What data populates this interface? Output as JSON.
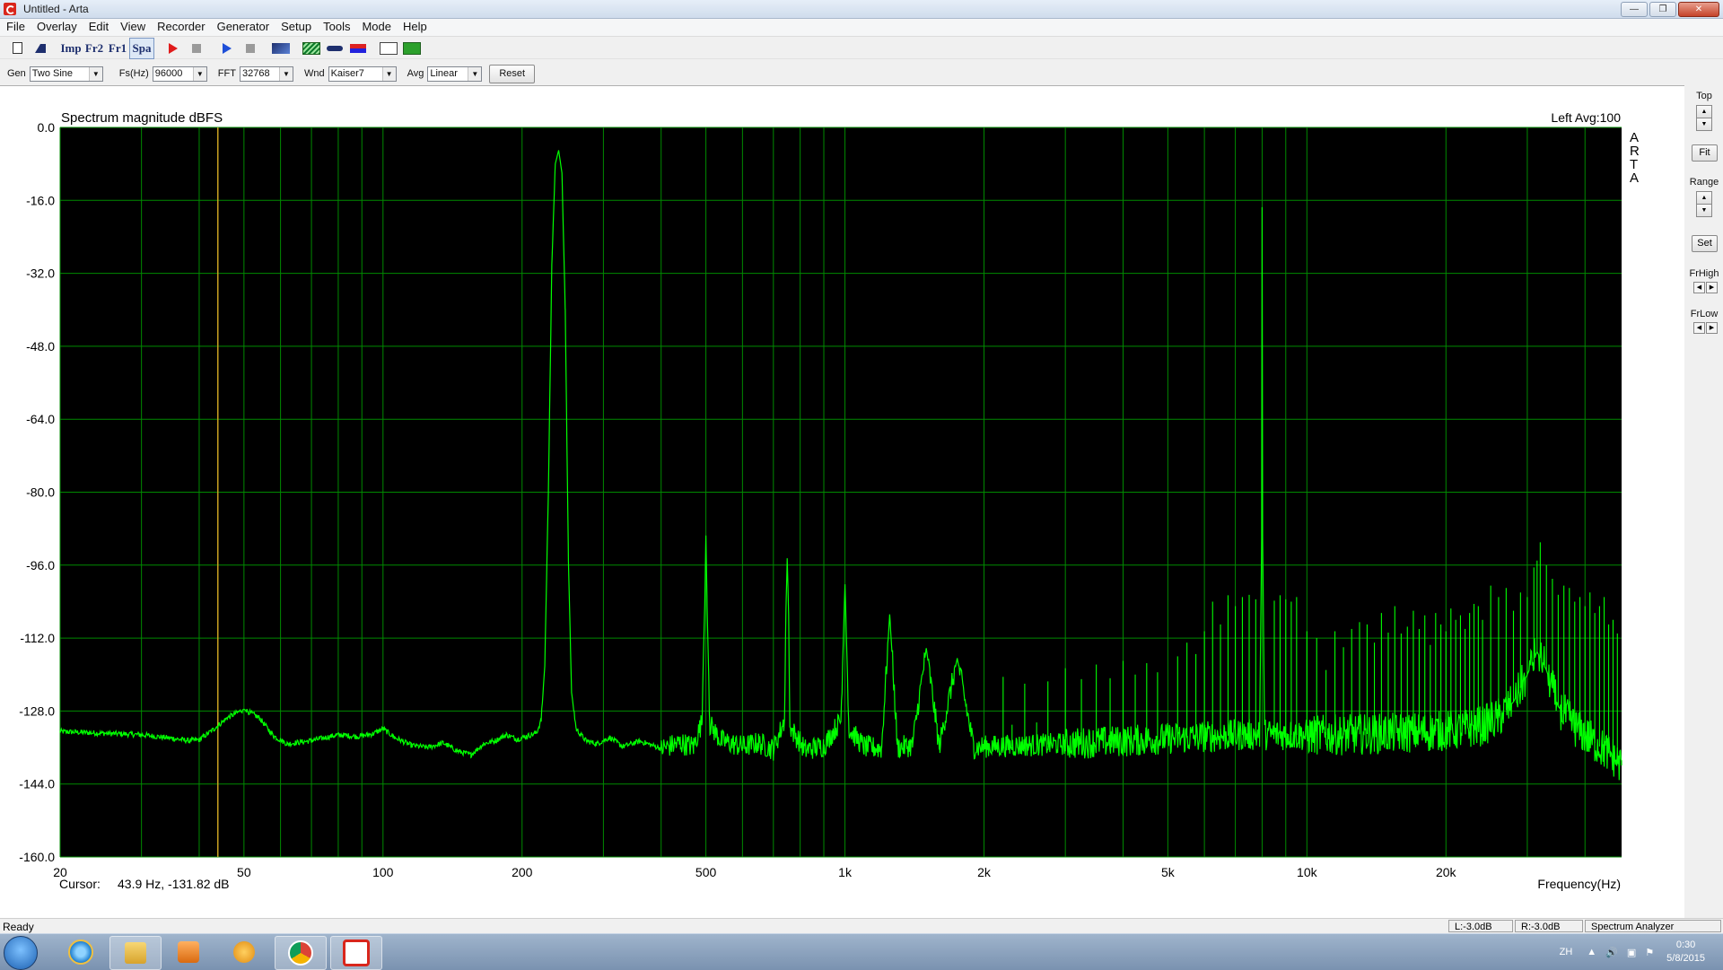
{
  "window": {
    "title": "Untitled - Arta",
    "min": "—",
    "max": "❐",
    "close": "✕"
  },
  "menu": [
    "File",
    "Overlay",
    "Edit",
    "View",
    "Recorder",
    "Generator",
    "Setup",
    "Tools",
    "Mode",
    "Help"
  ],
  "toolbar": {
    "imp": "Imp",
    "fr2": "Fr2",
    "fr1": "Fr1",
    "spa": "Spa"
  },
  "controls": {
    "gen_label": "Gen",
    "gen_value": "Two Sine",
    "fs_label": "Fs(Hz)",
    "fs_value": "96000",
    "fft_label": "FFT",
    "fft_value": "32768",
    "wnd_label": "Wnd",
    "wnd_value": "Kaiser7",
    "avg_label": "Avg",
    "avg_value": "Linear",
    "reset_label": "Reset"
  },
  "plot": {
    "title": "Spectrum magnitude dBFS",
    "channel_info": "Left  Avg:100",
    "watermark": [
      "A",
      "R",
      "T",
      "A"
    ],
    "cursor_label": "Cursor:",
    "cursor_value": "43.9 Hz, -131.82 dB",
    "xlabel": "Frequency(Hz)"
  },
  "right_panel": {
    "top_label": "Top",
    "fit_label": "Fit",
    "range_label": "Range",
    "set_label": "Set",
    "frhigh_label": "FrHigh",
    "frlow_label": "FrLow"
  },
  "status": {
    "ready": "Ready",
    "left_gain": "L:-3.0dB",
    "right_gain": "R:-3.0dB",
    "mode": "Spectrum Analyzer"
  },
  "tray": {
    "lang": "ZH",
    "time": "0:30",
    "date": "5/8/2015"
  },
  "chart_data": {
    "type": "line",
    "title": "Spectrum magnitude dBFS",
    "xlabel": "Frequency(Hz)",
    "ylabel": "",
    "x_scale": "log",
    "xlim": [
      20,
      48000
    ],
    "ylim": [
      -160,
      0
    ],
    "grid": true,
    "x_tick_labels": [
      {
        "f": 20,
        "label": "20"
      },
      {
        "f": 50,
        "label": "50"
      },
      {
        "f": 100,
        "label": "100"
      },
      {
        "f": 200,
        "label": "200"
      },
      {
        "f": 500,
        "label": "500"
      },
      {
        "f": 1000,
        "label": "1k"
      },
      {
        "f": 2000,
        "label": "2k"
      },
      {
        "f": 5000,
        "label": "5k"
      },
      {
        "f": 10000,
        "label": "10k"
      },
      {
        "f": 20000,
        "label": "20k"
      }
    ],
    "y_ticks": [
      "0.0",
      "-16.0",
      "-32.0",
      "-48.0",
      "-64.0",
      "-80.0",
      "-96.0",
      "-112.0",
      "-128.0",
      "-144.0",
      "-160.0"
    ],
    "cursor_freq": 43.9,
    "line_color": "#00ff00",
    "grid_color": "#008a00",
    "cursor_color": "#c8a020",
    "series": [
      {
        "points": [
          [
            20,
            -132.5
          ],
          [
            30,
            -133.2
          ],
          [
            35,
            -134.0
          ],
          [
            38,
            -134.5
          ],
          [
            40,
            -134.3
          ],
          [
            43,
            -132.0
          ],
          [
            46,
            -129.5
          ],
          [
            50,
            -127.6
          ],
          [
            54,
            -129.5
          ],
          [
            58,
            -133.5
          ],
          [
            62,
            -135.2
          ],
          [
            70,
            -134.5
          ],
          [
            80,
            -133.2
          ],
          [
            88,
            -133.6
          ],
          [
            95,
            -133.0
          ],
          [
            100,
            -131.9
          ],
          [
            106,
            -133.8
          ],
          [
            115,
            -135.5
          ],
          [
            125,
            -136.0
          ],
          [
            135,
            -135.0
          ],
          [
            145,
            -136.8
          ],
          [
            155,
            -137.6
          ],
          [
            165,
            -135.2
          ],
          [
            175,
            -134.5
          ],
          [
            185,
            -133.2
          ],
          [
            195,
            -134.2
          ],
          [
            205,
            -133.5
          ],
          [
            215,
            -132.8
          ],
          [
            220,
            -130.0
          ],
          [
            224,
            -118.0
          ],
          [
            228,
            -80.0
          ],
          [
            232,
            -30.0
          ],
          [
            236,
            -8.0
          ],
          [
            240,
            -5.0
          ],
          [
            244,
            -10.0
          ],
          [
            248,
            -40.0
          ],
          [
            252,
            -95.0
          ],
          [
            256,
            -124.0
          ],
          [
            262,
            -132.0
          ],
          [
            275,
            -134.5
          ],
          [
            290,
            -135.2
          ],
          [
            310,
            -133.8
          ],
          [
            330,
            -135.8
          ],
          [
            360,
            -134.6
          ],
          [
            400,
            -136.2
          ],
          [
            440,
            -135.0
          ],
          [
            470,
            -135.8
          ],
          [
            490,
            -130.5
          ],
          [
            497,
            -105.0
          ],
          [
            500,
            -89.5
          ],
          [
            503,
            -105.0
          ],
          [
            510,
            -131.0
          ],
          [
            540,
            -134.5
          ],
          [
            600,
            -135.8
          ],
          [
            650,
            -135.0
          ],
          [
            700,
            -136.4
          ],
          [
            740,
            -130.0
          ],
          [
            745,
            -106.0
          ],
          [
            750,
            -94.5
          ],
          [
            755,
            -106.0
          ],
          [
            760,
            -131.5
          ],
          [
            820,
            -136.5
          ],
          [
            900,
            -135.6
          ],
          [
            980,
            -130.0
          ],
          [
            995,
            -108.0
          ],
          [
            1000,
            -100.2
          ],
          [
            1005,
            -108.0
          ],
          [
            1020,
            -132.0
          ],
          [
            1100,
            -135.8
          ],
          [
            1200,
            -136.2
          ],
          [
            1250,
            -106.8
          ],
          [
            1300,
            -136.0
          ],
          [
            1400,
            -135.5
          ],
          [
            1500,
            -114.2
          ],
          [
            1600,
            -135.8
          ],
          [
            1750,
            -116.4
          ],
          [
            1900,
            -136.0
          ],
          [
            2000,
            -135.8
          ],
          [
            2500,
            -135.5
          ],
          [
            3000,
            -135.2
          ],
          [
            3500,
            -134.8
          ],
          [
            4000,
            -134.6
          ],
          [
            4500,
            -134.3
          ],
          [
            5000,
            -134.0
          ],
          [
            5500,
            -133.9
          ],
          [
            6000,
            -133.6
          ],
          [
            6500,
            -133.5
          ],
          [
            7000,
            -133.3
          ],
          [
            7500,
            -133.2
          ],
          [
            7900,
            -133.2
          ],
          [
            7980,
            -90.0
          ],
          [
            8000,
            -17.5
          ],
          [
            8020,
            -90.0
          ],
          [
            8100,
            -133.1
          ],
          [
            9000,
            -133.2
          ],
          [
            10000,
            -133.3
          ],
          [
            12000,
            -133.2
          ],
          [
            14000,
            -133.0
          ],
          [
            16000,
            -132.8
          ],
          [
            18000,
            -132.6
          ],
          [
            20000,
            -132.3
          ],
          [
            22000,
            -132.0
          ],
          [
            24000,
            -131.2
          ],
          [
            26000,
            -129.5
          ],
          [
            28000,
            -126.0
          ],
          [
            30000,
            -120.0
          ],
          [
            31500,
            -115.0
          ],
          [
            33000,
            -119.0
          ],
          [
            35000,
            -127.0
          ],
          [
            38000,
            -131.5
          ],
          [
            42000,
            -135.0
          ],
          [
            46000,
            -138.0
          ],
          [
            48000,
            -140.0
          ]
        ],
        "spurs": [
          [
            2200,
            -120.5
          ],
          [
            2300,
            -131.0
          ],
          [
            2450,
            -122.0
          ],
          [
            2600,
            -130.5
          ],
          [
            2750,
            -121.5
          ],
          [
            3000,
            -118.6
          ],
          [
            3250,
            -121.0
          ],
          [
            3500,
            -117.8
          ],
          [
            3750,
            -120.8
          ],
          [
            4000,
            -117.0
          ],
          [
            4250,
            -120.0
          ],
          [
            4500,
            -117.5
          ],
          [
            4750,
            -119.5
          ],
          [
            5250,
            -116.0
          ],
          [
            5500,
            -113.0
          ],
          [
            5750,
            -115.5
          ],
          [
            6000,
            -110.5
          ],
          [
            6250,
            -104.0
          ],
          [
            6500,
            -109.0
          ],
          [
            6750,
            -102.6
          ],
          [
            7000,
            -105.0
          ],
          [
            7250,
            -103.0
          ],
          [
            7500,
            -102.5
          ],
          [
            7750,
            -103.5
          ],
          [
            8500,
            -103.8
          ],
          [
            8750,
            -102.6
          ],
          [
            9000,
            -103.5
          ],
          [
            9250,
            -104.0
          ],
          [
            9500,
            -103.0
          ],
          [
            10000,
            -110.5
          ],
          [
            10500,
            -112.0
          ],
          [
            11000,
            -119.0
          ],
          [
            11500,
            -110.5
          ],
          [
            12000,
            -114.0
          ],
          [
            12500,
            -110.0
          ],
          [
            13000,
            -108.5
          ],
          [
            13500,
            -109.0
          ],
          [
            14000,
            -113.0
          ],
          [
            14500,
            -106.5
          ],
          [
            15000,
            -110.8
          ],
          [
            15500,
            -105.0
          ],
          [
            16000,
            -111.0
          ],
          [
            16500,
            -109.5
          ],
          [
            17000,
            -106.0
          ],
          [
            17500,
            -110.0
          ],
          [
            18000,
            -107.0
          ],
          [
            18500,
            -113.5
          ],
          [
            19000,
            -106.5
          ],
          [
            19500,
            -109.0
          ],
          [
            20000,
            -110.5
          ],
          [
            20500,
            -105.5
          ],
          [
            21000,
            -108.0
          ],
          [
            21500,
            -107.0
          ],
          [
            22000,
            -110.0
          ],
          [
            22500,
            -106.5
          ],
          [
            23000,
            -104.5
          ],
          [
            23500,
            -105.0
          ],
          [
            24000,
            -108.0
          ],
          [
            25000,
            -100.5
          ],
          [
            26000,
            -103.0
          ],
          [
            27000,
            -101.0
          ],
          [
            28000,
            -106.0
          ],
          [
            29000,
            -102.0
          ],
          [
            30000,
            -103.0
          ],
          [
            31000,
            -96.5
          ],
          [
            31500,
            -95.0
          ],
          [
            32000,
            -91.0
          ],
          [
            33000,
            -96.0
          ],
          [
            34000,
            -99.0
          ],
          [
            35000,
            -102.5
          ],
          [
            36000,
            -100.5
          ],
          [
            37000,
            -101.0
          ],
          [
            38000,
            -104.0
          ],
          [
            39000,
            -103.0
          ],
          [
            40000,
            -105.0
          ],
          [
            41000,
            -102.0
          ],
          [
            42000,
            -106.5
          ],
          [
            43000,
            -105.0
          ],
          [
            44000,
            -103.0
          ],
          [
            45000,
            -109.0
          ],
          [
            46000,
            -108.0
          ],
          [
            47000,
            -111.0
          ]
        ]
      }
    ]
  }
}
